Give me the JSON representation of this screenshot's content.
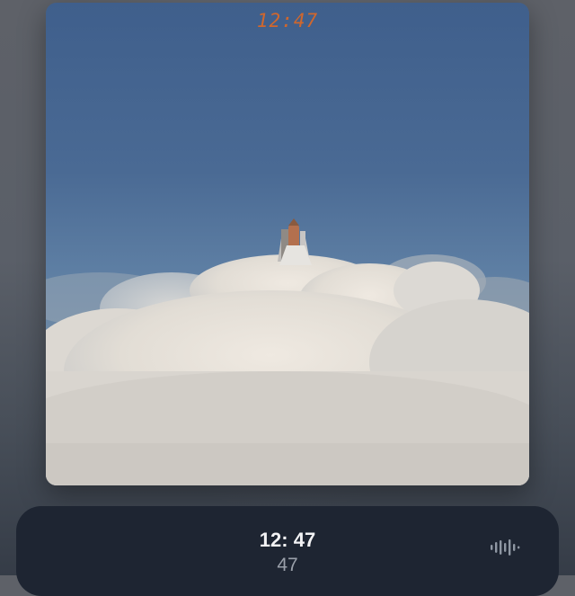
{
  "artwork": {
    "overlay_time": "12:47"
  },
  "now_playing": {
    "title": "12: 47",
    "artist": "47",
    "waveform_icon": "waveform-icon"
  },
  "colors": {
    "overlay_time": "#d0672d",
    "player_background": "#1e2532"
  }
}
